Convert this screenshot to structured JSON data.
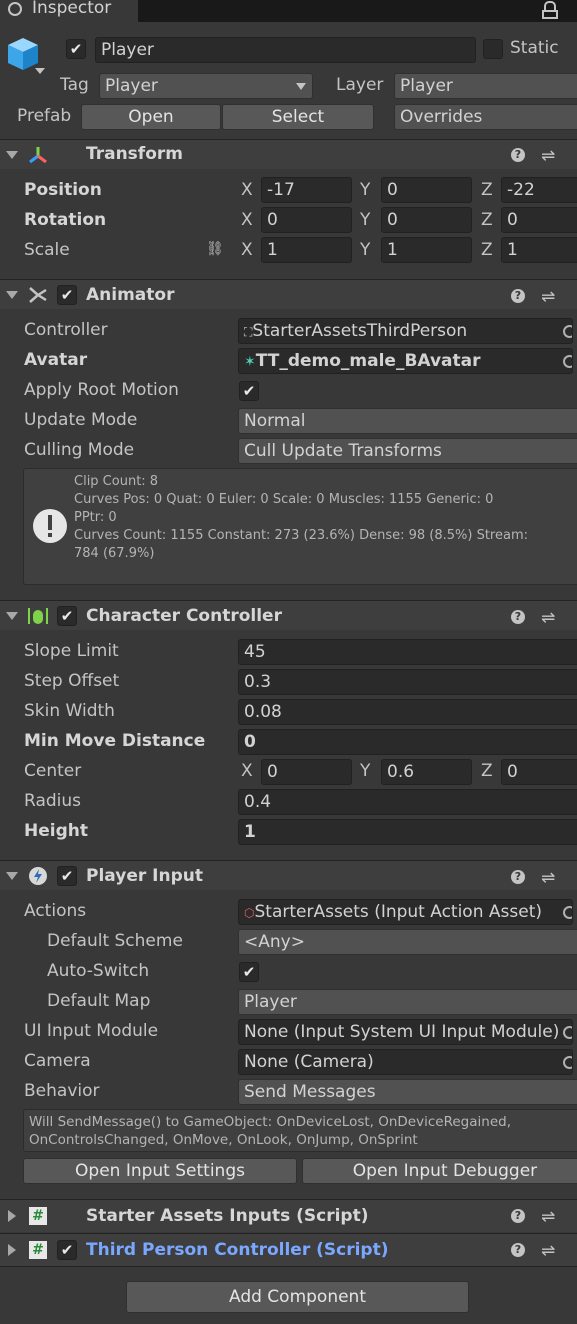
{
  "tab": {
    "title": "Inspector"
  },
  "object": {
    "name": "Player",
    "static_label": "Static",
    "tag_label": "Tag",
    "tag_value": "Player",
    "layer_label": "Layer",
    "layer_value": "Player",
    "prefab_label": "Prefab",
    "open_label": "Open",
    "select_label": "Select",
    "overrides_label": "Overrides"
  },
  "transform": {
    "title": "Transform",
    "position_label": "Position",
    "rotation_label": "Rotation",
    "scale_label": "Scale",
    "x": "X",
    "y": "Y",
    "z": "Z",
    "position": {
      "x": "-17",
      "y": "0",
      "z": "-22"
    },
    "rotation": {
      "x": "0",
      "y": "0",
      "z": "0"
    },
    "scale": {
      "x": "1",
      "y": "1",
      "z": "1"
    }
  },
  "animator": {
    "title": "Animator",
    "controller_label": "Controller",
    "controller_value": "StarterAssetsThirdPerson",
    "avatar_label": "Avatar",
    "avatar_value": "TT_demo_male_BAvatar",
    "root_motion_label": "Apply Root Motion",
    "update_mode_label": "Update Mode",
    "update_mode_value": "Normal",
    "culling_mode_label": "Culling Mode",
    "culling_mode_value": "Cull Update Transforms",
    "info": [
      "Clip Count: 8",
      "Curves Pos: 0 Quat: 0 Euler: 0 Scale: 0 Muscles: 1155 Generic: 0",
      "PPtr: 0",
      "Curves Count: 1155 Constant: 273 (23.6%) Dense: 98 (8.5%) Stream:",
      "784 (67.9%)"
    ]
  },
  "character_controller": {
    "title": "Character Controller",
    "slope_limit_label": "Slope Limit",
    "slope_limit_value": "45",
    "step_offset_label": "Step Offset",
    "step_offset_value": "0.3",
    "skin_width_label": "Skin Width",
    "skin_width_value": "0.08",
    "min_move_label": "Min Move Distance",
    "min_move_value": "0",
    "center_label": "Center",
    "center": {
      "x": "0",
      "y": "0.6",
      "z": "0"
    },
    "radius_label": "Radius",
    "radius_value": "0.4",
    "height_label": "Height",
    "height_value": "1"
  },
  "player_input": {
    "title": "Player Input",
    "actions_label": "Actions",
    "actions_value": "StarterAssets (Input Action Asset)",
    "default_scheme_label": "Default Scheme",
    "default_scheme_value": "<Any>",
    "auto_switch_label": "Auto-Switch",
    "default_map_label": "Default Map",
    "default_map_value": "Player",
    "ui_input_label": "UI Input Module",
    "ui_input_value": "None (Input System UI Input Module)",
    "camera_label": "Camera",
    "camera_value": "None (Camera)",
    "behavior_label": "Behavior",
    "behavior_value": "Send Messages",
    "message_line1": "Will SendMessage() to GameObject: OnDeviceLost, OnDeviceRegained,",
    "message_line2": "OnControlsChanged, OnMove, OnLook, OnJump, OnSprint",
    "open_settings_label": "Open Input Settings",
    "open_debugger_label": "Open Input Debugger"
  },
  "scripts": {
    "starter_assets_inputs": "Starter Assets Inputs (Script)",
    "third_person_controller": "Third Person Controller (Script)"
  },
  "add_component_label": "Add Component",
  "colors": {
    "background": "#383838",
    "field": "#2a2a2a",
    "link_blue": "#7aa7ff",
    "accent_green": "#7fd34a"
  }
}
